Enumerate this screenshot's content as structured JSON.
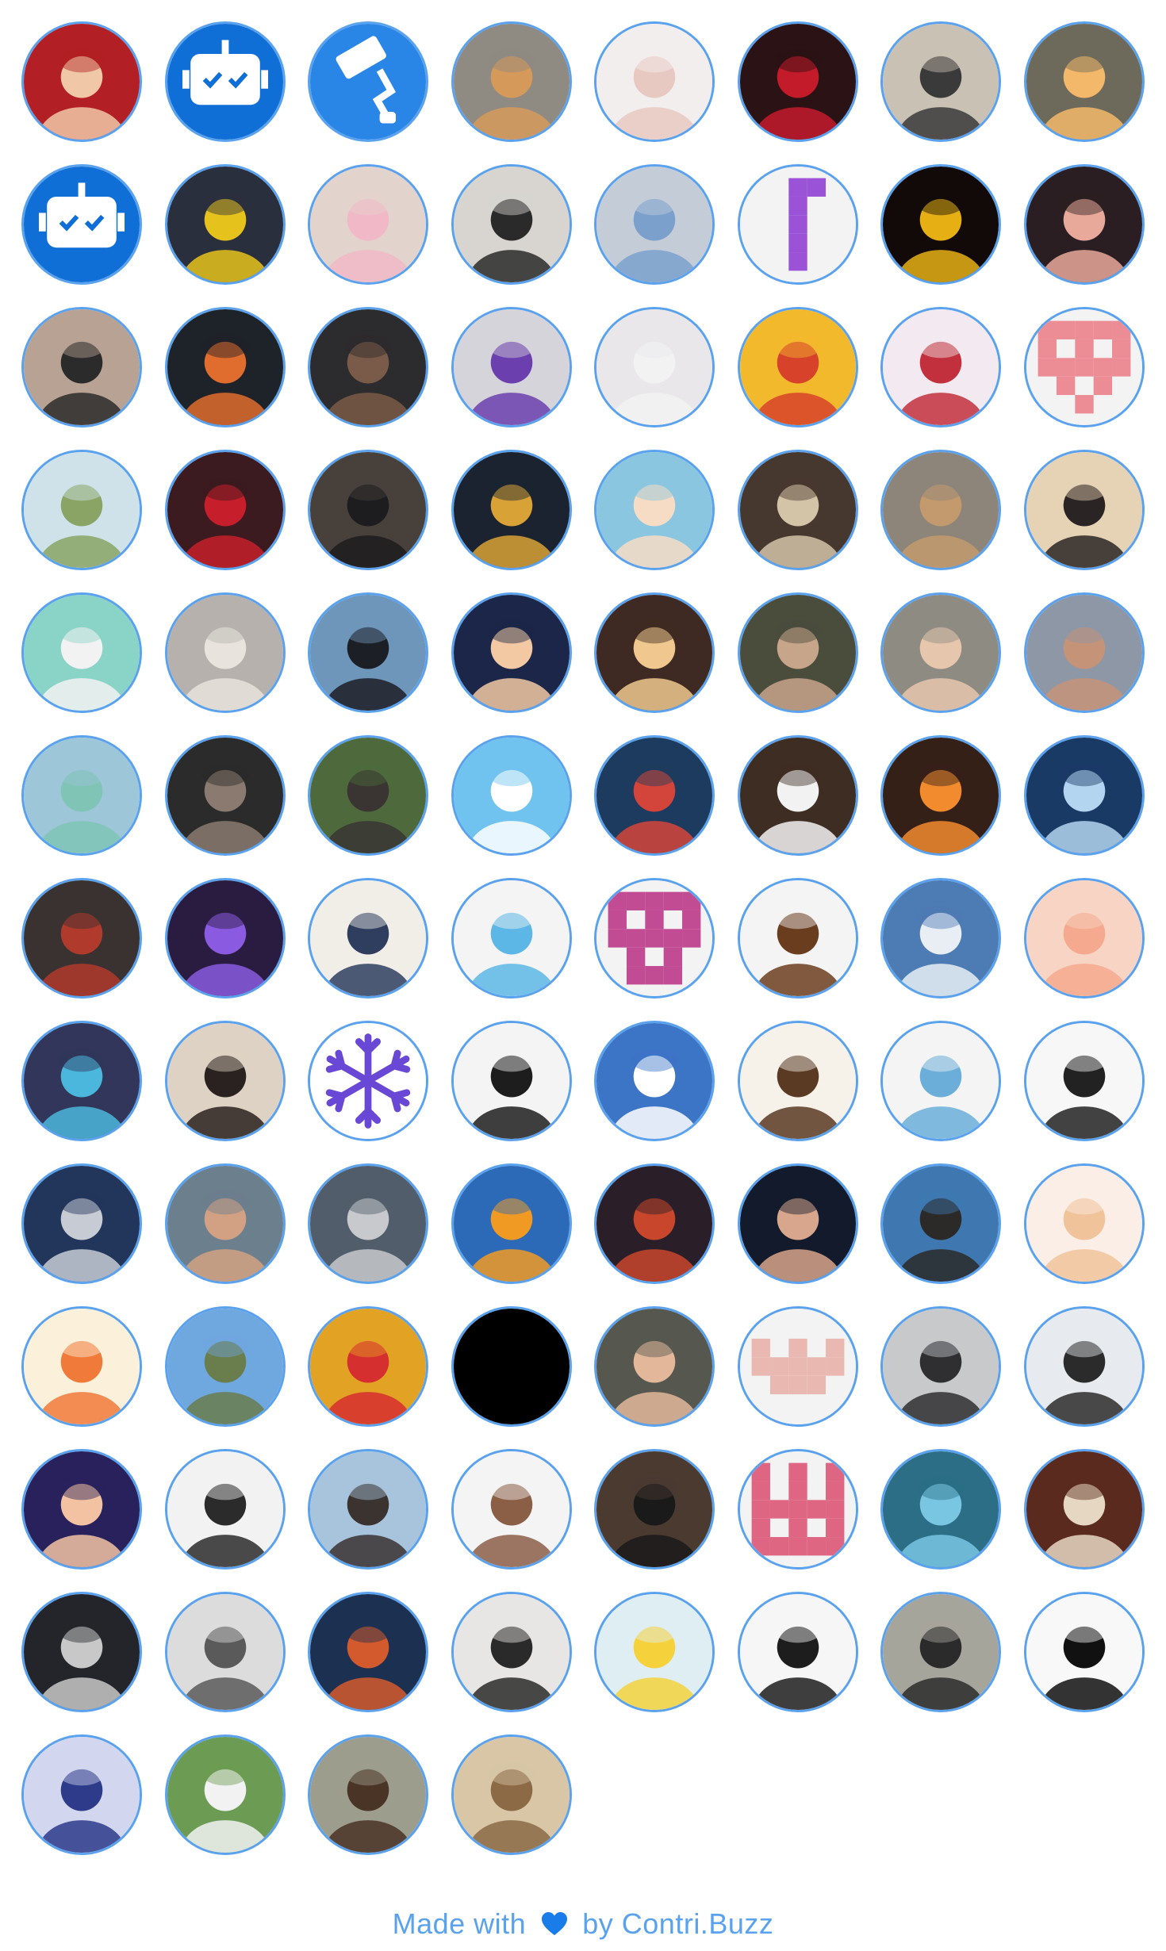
{
  "footer": {
    "prefix": "Made with",
    "by": "by",
    "link": "Contri.Buzz",
    "heart_icon": "blue-heart-icon",
    "color": "#5aa2ee"
  },
  "colors": {
    "ring": "#5aa2ee"
  },
  "contributors": [
    {
      "kind": "photo",
      "bg": "#b21f24",
      "fg": "#f0c8a8"
    },
    {
      "kind": "bot",
      "bg": "#0f6fd6",
      "fg": "#ffffff"
    },
    {
      "kind": "brush",
      "bg": "#2a86e6",
      "fg": "#ffffff"
    },
    {
      "kind": "photo",
      "bg": "#8f8a82",
      "fg": "#d59a5a"
    },
    {
      "kind": "photo",
      "bg": "#f3eeee",
      "fg": "#e7c9c2"
    },
    {
      "kind": "photo",
      "bg": "#2b1214",
      "fg": "#c41b2b"
    },
    {
      "kind": "photo",
      "bg": "#c9c1b4",
      "fg": "#3b3a3a"
    },
    {
      "kind": "photo",
      "bg": "#6d6a5c",
      "fg": "#f3b86a"
    },
    {
      "kind": "bot",
      "bg": "#0f6fd6",
      "fg": "#ffffff"
    },
    {
      "kind": "photo",
      "bg": "#2a2f3d",
      "fg": "#e6c21c"
    },
    {
      "kind": "photo",
      "bg": "#e3d3cd",
      "fg": "#f1b8c7"
    },
    {
      "kind": "photo",
      "bg": "#d8d5d0",
      "fg": "#2a2a2a"
    },
    {
      "kind": "photo",
      "bg": "#c4ccd7",
      "fg": "#7ba0cc"
    },
    {
      "kind": "identicon",
      "bg": "#f3f3f3",
      "fg": "#9a52d6",
      "pattern": [
        [
          0,
          0,
          1,
          1,
          0
        ],
        [
          0,
          0,
          1,
          0,
          0
        ],
        [
          0,
          0,
          1,
          0,
          0
        ],
        [
          0,
          0,
          1,
          0,
          0
        ],
        [
          0,
          0,
          1,
          0,
          0
        ]
      ]
    },
    {
      "kind": "photo",
      "bg": "#120a08",
      "fg": "#e6b014"
    },
    {
      "kind": "photo",
      "bg": "#2b1e22",
      "fg": "#e9a99a"
    },
    {
      "kind": "photo",
      "bg": "#b8a294",
      "fg": "#2b2b2b"
    },
    {
      "kind": "photo",
      "bg": "#1e2229",
      "fg": "#e06c2e"
    },
    {
      "kind": "photo",
      "bg": "#2c2b2d",
      "fg": "#7a5a48"
    },
    {
      "kind": "photo",
      "bg": "#d5d4da",
      "fg": "#6b3fae"
    },
    {
      "kind": "photo",
      "bg": "#e9e7ea",
      "fg": "#f2f2f2"
    },
    {
      "kind": "photo",
      "bg": "#f3b92d",
      "fg": "#d6422a"
    },
    {
      "kind": "photo",
      "bg": "#f2eaf0",
      "fg": "#c2303d"
    },
    {
      "kind": "identicon",
      "bg": "#f3f3f3",
      "fg": "#ec8d96",
      "pattern": [
        [
          1,
          1,
          1,
          1,
          1
        ],
        [
          1,
          0,
          1,
          0,
          1
        ],
        [
          1,
          1,
          1,
          1,
          1
        ],
        [
          0,
          1,
          0,
          1,
          0
        ],
        [
          0,
          0,
          1,
          0,
          0
        ]
      ]
    },
    {
      "kind": "photo",
      "bg": "#cfe2ea",
      "fg": "#8aa465"
    },
    {
      "kind": "photo",
      "bg": "#3b1b20",
      "fg": "#c61e2a"
    },
    {
      "kind": "photo",
      "bg": "#47403b",
      "fg": "#1d1c1e"
    },
    {
      "kind": "photo",
      "bg": "#1b2331",
      "fg": "#d9a236"
    },
    {
      "kind": "photo",
      "bg": "#8bc6e1",
      "fg": "#f6dcc4"
    },
    {
      "kind": "photo",
      "bg": "#47382f",
      "fg": "#d3c3a7"
    },
    {
      "kind": "photo",
      "bg": "#8d8579",
      "fg": "#c39a6e"
    },
    {
      "kind": "photo",
      "bg": "#e6d3b6",
      "fg": "#2a2424"
    },
    {
      "kind": "photo",
      "bg": "#8ad3c7",
      "fg": "#f2f2f2"
    },
    {
      "kind": "photo",
      "bg": "#b6b1ad",
      "fg": "#e8e3dc"
    },
    {
      "kind": "photo",
      "bg": "#6e95ba",
      "fg": "#1d1f26"
    },
    {
      "kind": "photo",
      "bg": "#1b2648",
      "fg": "#f2c9a3"
    },
    {
      "kind": "photo",
      "bg": "#3e2a22",
      "fg": "#f0c88f"
    },
    {
      "kind": "photo",
      "bg": "#4a4c3c",
      "fg": "#c7a58a"
    },
    {
      "kind": "photo",
      "bg": "#8e8b83",
      "fg": "#e6c6ad"
    },
    {
      "kind": "photo",
      "bg": "#8e97a6",
      "fg": "#c59378"
    },
    {
      "kind": "photo",
      "bg": "#9dc6d9",
      "fg": "#7fc4b5"
    },
    {
      "kind": "photo",
      "bg": "#2b2b2b",
      "fg": "#8a7a6f"
    },
    {
      "kind": "photo",
      "bg": "#4e6a3c",
      "fg": "#3a3532"
    },
    {
      "kind": "photo",
      "bg": "#6fc3ee",
      "fg": "#ffffff"
    },
    {
      "kind": "photo",
      "bg": "#1d3b5e",
      "fg": "#d3453a"
    },
    {
      "kind": "photo",
      "bg": "#3e2d23",
      "fg": "#f2f2f2"
    },
    {
      "kind": "photo",
      "bg": "#352018",
      "fg": "#f18b2e"
    },
    {
      "kind": "photo",
      "bg": "#1a3a66",
      "fg": "#b3d5ef"
    },
    {
      "kind": "photo",
      "bg": "#3a3230",
      "fg": "#b03a2c"
    },
    {
      "kind": "photo",
      "bg": "#2a1c40",
      "fg": "#8a5ae0"
    },
    {
      "kind": "photo",
      "bg": "#f1eee8",
      "fg": "#2f3e5f"
    },
    {
      "kind": "photo",
      "bg": "#f4f4f4",
      "fg": "#5cb6e6"
    },
    {
      "kind": "identicon",
      "bg": "#f3f3f3",
      "fg": "#c24c93",
      "pattern": [
        [
          1,
          1,
          1,
          1,
          1
        ],
        [
          1,
          0,
          1,
          0,
          1
        ],
        [
          1,
          1,
          1,
          1,
          1
        ],
        [
          0,
          1,
          0,
          1,
          0
        ],
        [
          0,
          1,
          1,
          1,
          0
        ]
      ]
    },
    {
      "kind": "photo",
      "bg": "#f4f4f4",
      "fg": "#6b3d1f"
    },
    {
      "kind": "photo",
      "bg": "#4d7bb3",
      "fg": "#e8eef4"
    },
    {
      "kind": "photo",
      "bg": "#f7d4c4",
      "fg": "#f5a98e"
    },
    {
      "kind": "photo",
      "bg": "#31365a",
      "fg": "#4bb7dc"
    },
    {
      "kind": "photo",
      "bg": "#ded2c4",
      "fg": "#2a2220"
    },
    {
      "kind": "snow",
      "bg": "#ffffff",
      "fg": "#6a48d6"
    },
    {
      "kind": "photo",
      "bg": "#f4f4f4",
      "fg": "#1d1d1d"
    },
    {
      "kind": "photo",
      "bg": "#3c74c6",
      "fg": "#ffffff"
    },
    {
      "kind": "photo",
      "bg": "#f6f2ea",
      "fg": "#5a3a22"
    },
    {
      "kind": "photo",
      "bg": "#f4f4f4",
      "fg": "#6aaed9"
    },
    {
      "kind": "photo",
      "bg": "#f7f7f7",
      "fg": "#222222"
    },
    {
      "kind": "photo",
      "bg": "#22365c",
      "fg": "#c7cbd4"
    },
    {
      "kind": "photo",
      "bg": "#6c7f8d",
      "fg": "#d2a183"
    },
    {
      "kind": "photo",
      "bg": "#515d6b",
      "fg": "#c7c9cc"
    },
    {
      "kind": "photo",
      "bg": "#2c6ab8",
      "fg": "#f19a23"
    },
    {
      "kind": "photo",
      "bg": "#2a1e28",
      "fg": "#c8472c"
    },
    {
      "kind": "photo",
      "bg": "#131a2c",
      "fg": "#d8a68c"
    },
    {
      "kind": "photo",
      "bg": "#3f78b1",
      "fg": "#2c2a29"
    },
    {
      "kind": "photo",
      "bg": "#fbeee6",
      "fg": "#f0c39a"
    },
    {
      "kind": "photo",
      "bg": "#fbf0d9",
      "fg": "#f07a3a"
    },
    {
      "kind": "photo",
      "bg": "#6fa7df",
      "fg": "#6a7d4c"
    },
    {
      "kind": "photo",
      "bg": "#e2a224",
      "fg": "#d62f2f"
    },
    {
      "kind": "black",
      "bg": "#000000",
      "fg": "#000000"
    },
    {
      "kind": "photo",
      "bg": "#56584f",
      "fg": "#e2b79a"
    },
    {
      "kind": "identicon",
      "bg": "#f3f3f3",
      "fg": "#e9b9b1",
      "pattern": [
        [
          0,
          0,
          0,
          0,
          0
        ],
        [
          1,
          0,
          1,
          0,
          1
        ],
        [
          1,
          1,
          1,
          1,
          1
        ],
        [
          0,
          1,
          1,
          1,
          0
        ],
        [
          0,
          0,
          0,
          0,
          0
        ]
      ]
    },
    {
      "kind": "photo",
      "bg": "#c7c9cb",
      "fg": "#2f2f32"
    },
    {
      "kind": "photo",
      "bg": "#e7eaee",
      "fg": "#2b2b2b"
    },
    {
      "kind": "photo",
      "bg": "#28215c",
      "fg": "#f2c2a2"
    },
    {
      "kind": "photo",
      "bg": "#f2f2f2",
      "fg": "#2b2b2b"
    },
    {
      "kind": "photo",
      "bg": "#a8c3dc",
      "fg": "#3a3330"
    },
    {
      "kind": "photo",
      "bg": "#f4f4f4",
      "fg": "#8b5e46"
    },
    {
      "kind": "photo",
      "bg": "#4a3a30",
      "fg": "#1a1a1a"
    },
    {
      "kind": "identicon",
      "bg": "#f3f3f3",
      "fg": "#df6682",
      "pattern": [
        [
          1,
          0,
          1,
          0,
          1
        ],
        [
          1,
          0,
          1,
          0,
          1
        ],
        [
          1,
          1,
          1,
          1,
          1
        ],
        [
          1,
          0,
          1,
          0,
          1
        ],
        [
          1,
          1,
          1,
          1,
          1
        ]
      ]
    },
    {
      "kind": "photo",
      "bg": "#2b6e86",
      "fg": "#79c6e2"
    },
    {
      "kind": "photo",
      "bg": "#5a2a1f",
      "fg": "#e6d7c2"
    },
    {
      "kind": "photo",
      "bg": "#24252a",
      "fg": "#c8c8c8"
    },
    {
      "kind": "photo",
      "bg": "#dcdcdc",
      "fg": "#5a5a5a"
    },
    {
      "kind": "photo",
      "bg": "#1c3152",
      "fg": "#d35a2d"
    },
    {
      "kind": "photo",
      "bg": "#e8e6e4",
      "fg": "#2a2a2a"
    },
    {
      "kind": "photo",
      "bg": "#dfeef3",
      "fg": "#f5d23b"
    },
    {
      "kind": "photo",
      "bg": "#f6f6f6",
      "fg": "#1d1d1d"
    },
    {
      "kind": "photo",
      "bg": "#a6a59c",
      "fg": "#2b2b2b"
    },
    {
      "kind": "photo",
      "bg": "#f8f8f8",
      "fg": "#111111"
    },
    {
      "kind": "photo",
      "bg": "#d2d6ef",
      "fg": "#2d3b8a"
    },
    {
      "kind": "photo",
      "bg": "#6c9b53",
      "fg": "#f2f2f2"
    },
    {
      "kind": "photo",
      "bg": "#9d9d8d",
      "fg": "#4a3426"
    },
    {
      "kind": "photo",
      "bg": "#d8c6a6",
      "fg": "#8b6a45"
    }
  ]
}
